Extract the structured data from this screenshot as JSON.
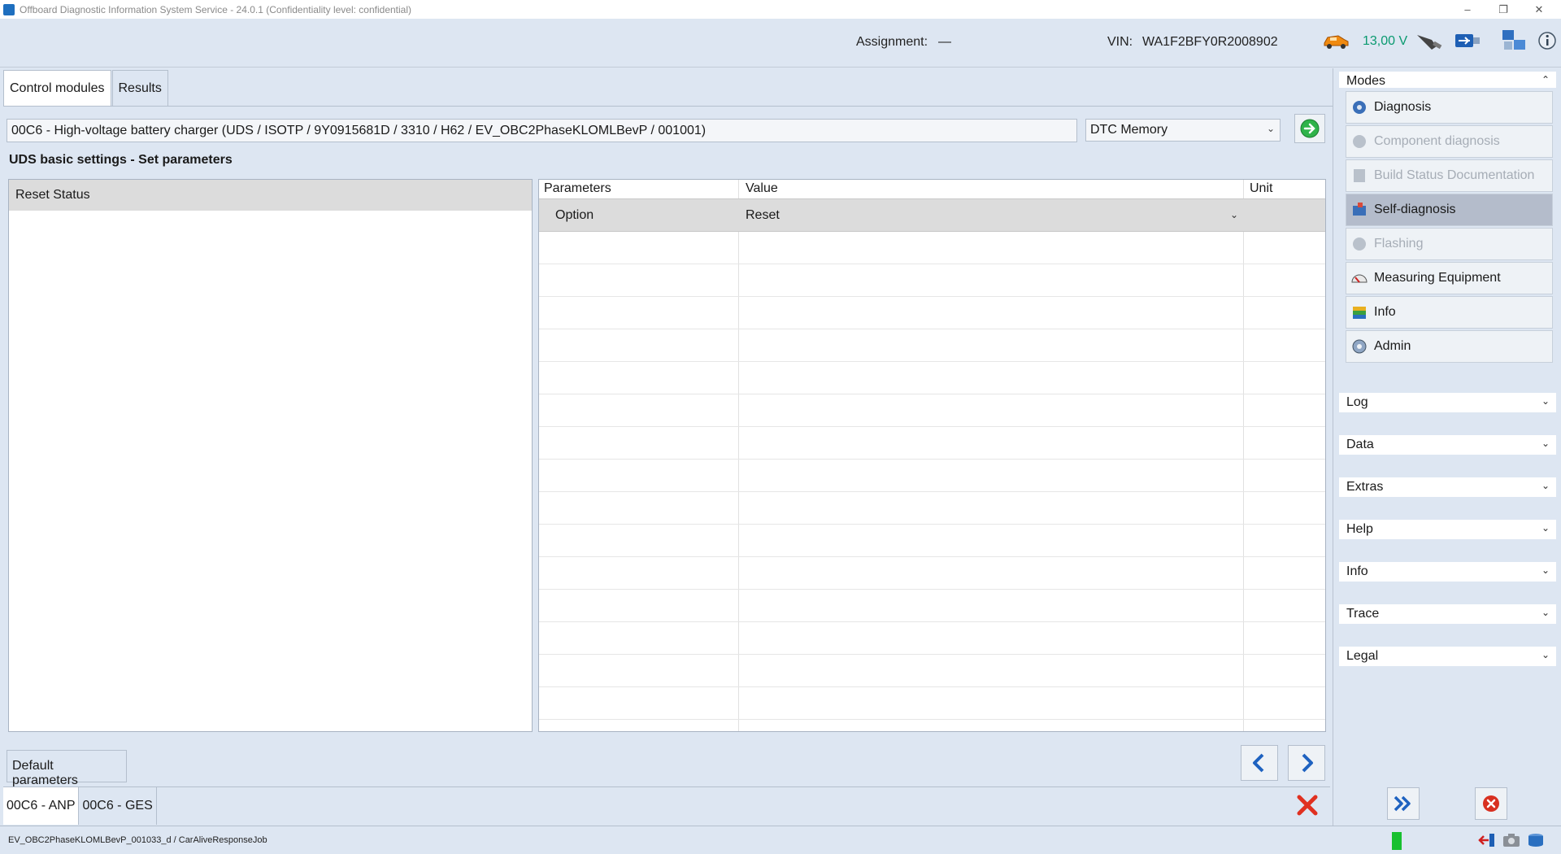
{
  "window": {
    "title": "Offboard Diagnostic Information System Service - 24.0.1 (Confidentiality level: confidential)",
    "minimize": "–",
    "restore": "❐",
    "close": "✕"
  },
  "header": {
    "assignment_label": "Assignment:",
    "assignment_value": "—",
    "vin_label": "VIN:",
    "vin_value": "WA1F2BFY0R2008902",
    "voltage": "13,00 V",
    "icons": [
      "car-icon",
      "plug-icon",
      "usb-icon",
      "network-icon",
      "info-icon"
    ]
  },
  "tabs": [
    {
      "label": "Control modules",
      "active": true
    },
    {
      "label": "Results",
      "active": false
    }
  ],
  "module_field": "00C6 - High-voltage battery charger  (UDS / ISOTP / 9Y0915681D / 3310 / H62 / EV_OBC2PhaseKLOMLBevP / 001001)",
  "view_select": "DTC Memory",
  "section_title": "UDS basic settings - Set parameters",
  "left_list": [
    "Reset Status"
  ],
  "param_table": {
    "columns": [
      "Parameters",
      "Value",
      "Unit"
    ],
    "rows": [
      {
        "parameter": "Option",
        "value": "Reset",
        "unit": ""
      }
    ]
  },
  "default_parameters_label": "Default parameters",
  "bottom_tabs": [
    {
      "label": "00C6 - ANP",
      "active": true
    },
    {
      "label": "00C6 - GES",
      "active": false
    }
  ],
  "right_panel": {
    "modes_title": "Modes",
    "modes": [
      {
        "label": "Diagnosis",
        "state": "normal",
        "icon": "stethoscope-icon"
      },
      {
        "label": "Component diagnosis",
        "state": "disabled",
        "icon": "wrench-icon"
      },
      {
        "label": "Build Status Documentation",
        "state": "disabled",
        "icon": "document-icon"
      },
      {
        "label": "Self-diagnosis",
        "state": "active",
        "icon": "self-diagnosis-icon"
      },
      {
        "label": "Flashing",
        "state": "disabled",
        "icon": "flash-icon"
      },
      {
        "label": "Measuring Equipment",
        "state": "normal",
        "icon": "gauge-icon"
      },
      {
        "label": "Info",
        "state": "normal",
        "icon": "books-icon"
      },
      {
        "label": "Admin",
        "state": "normal",
        "icon": "admin-gear-icon"
      }
    ],
    "sections": [
      "Log",
      "Data",
      "Extras",
      "Help",
      "Info",
      "Trace",
      "Legal"
    ]
  },
  "status_text": "EV_OBC2PhaseKLOMLBevP_001033_d / CarAliveResponseJob",
  "colors": {
    "accent_blue": "#1e62c0",
    "voltage_green": "#0a9a70",
    "status_green": "#18c030",
    "close_red": "#e03020"
  }
}
